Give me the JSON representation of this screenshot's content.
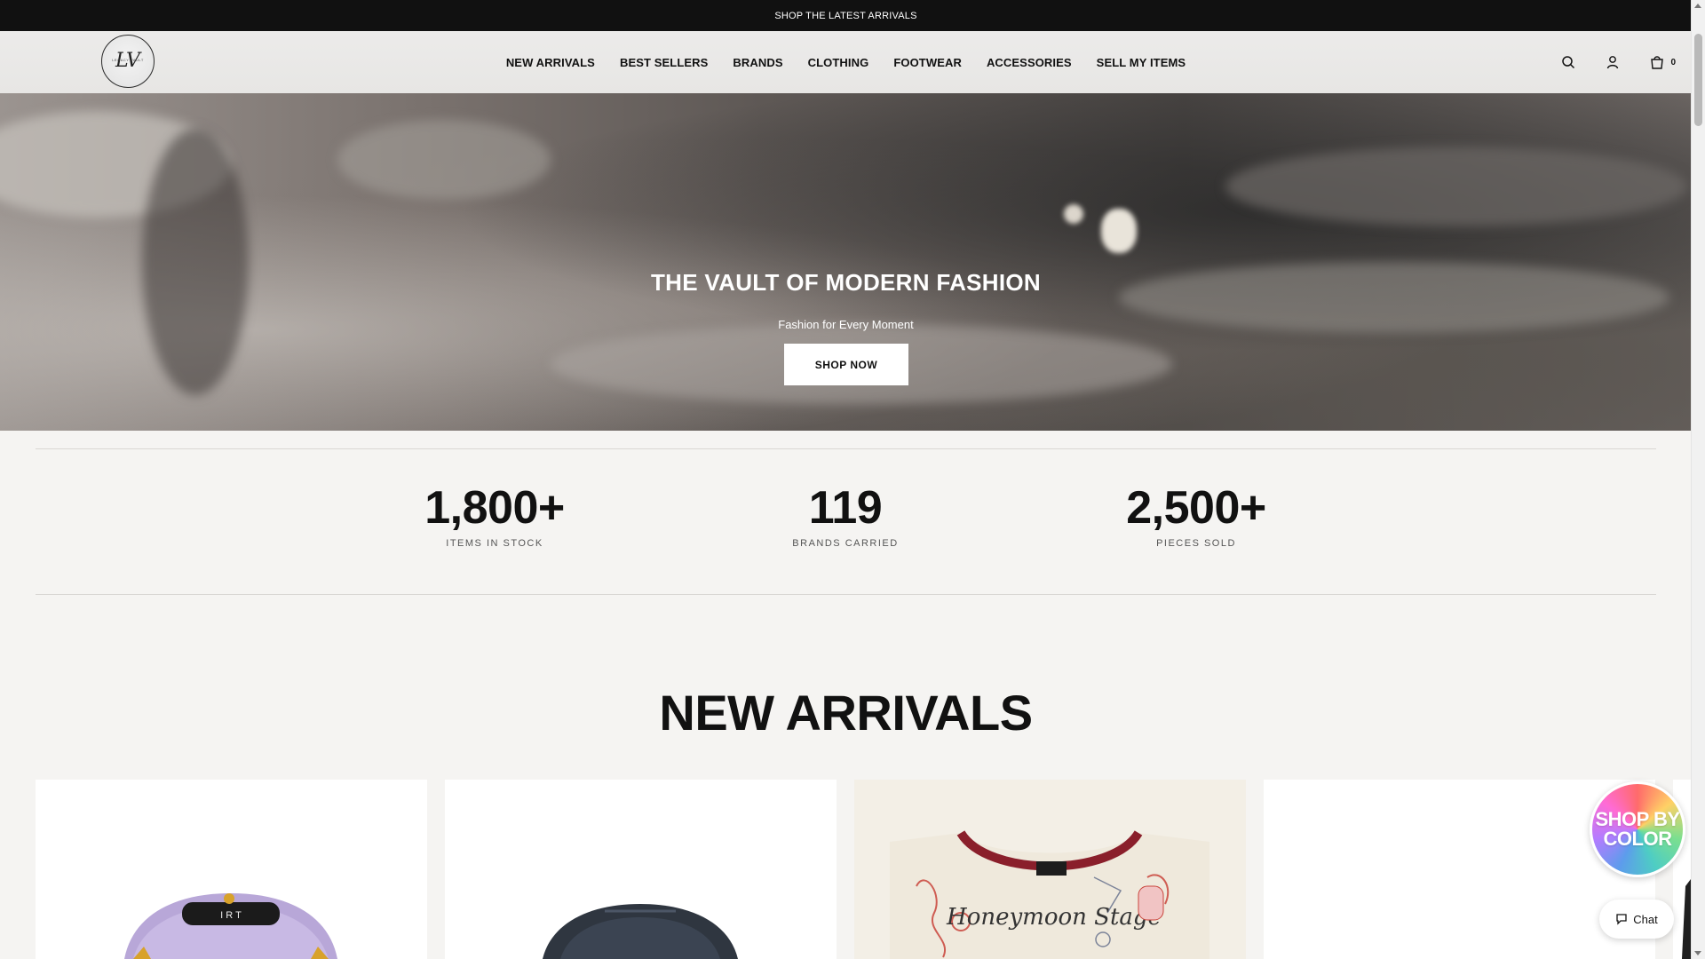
{
  "announcement": {
    "text": "SHOP THE LATEST ARRIVALS"
  },
  "header": {
    "logo_monogram": "LV",
    "logo_small_text": "LEGACY VAULT",
    "nav": [
      "NEW ARRIVALS",
      "BEST SELLERS",
      "BRANDS",
      "CLOTHING",
      "FOOTWEAR",
      "ACCESSORIES",
      "SELL MY ITEMS"
    ],
    "icons": [
      "search-icon",
      "account-icon",
      "cart-icon"
    ],
    "cart_count": "0"
  },
  "hero": {
    "title": "THE VAULT OF MODERN FASHION",
    "subtitle": "Fashion for Every Moment",
    "button": "SHOP NOW"
  },
  "stats": [
    {
      "value": "1,800+",
      "label": "ITEMS IN STOCK"
    },
    {
      "value": "119",
      "label": "BRANDS CARRIED"
    },
    {
      "value": "2,500+",
      "label": "PIECES SOLD"
    }
  ],
  "new_arrivals": {
    "title": "NEW ARRIVALS",
    "cards": [
      {
        "image": "purple-cap",
        "logo_text": "I R T"
      },
      {
        "image": "navy-cap"
      },
      {
        "image": "graphic-tee",
        "print_text": "Honeymoon Stage"
      },
      {
        "image": "blank"
      }
    ]
  },
  "widgets": {
    "shop_by_color": "SHOP BY COLOR",
    "chat": "Chat"
  },
  "colors": {
    "announcement_bg": "#111111",
    "page_bg": "#f5f4f2"
  }
}
